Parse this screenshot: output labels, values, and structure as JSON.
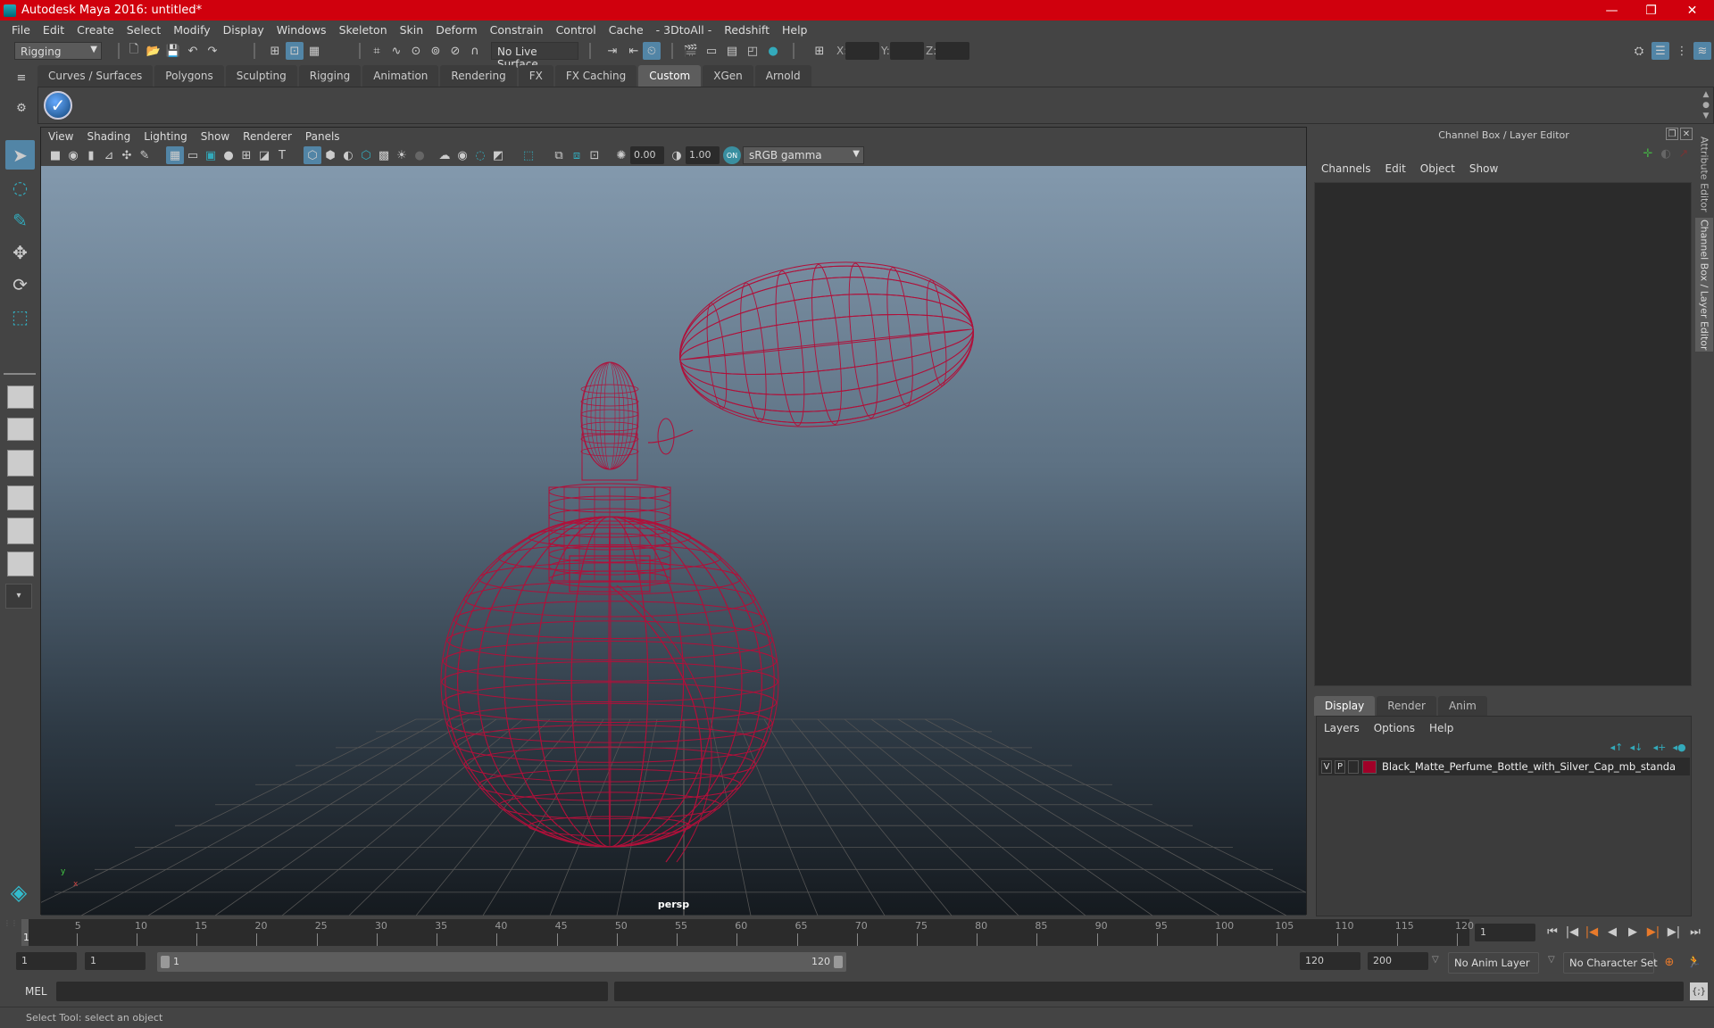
{
  "window": {
    "title": "Autodesk Maya 2016: untitled*",
    "controls": {
      "minimize": "—",
      "restore": "❐",
      "close": "✕"
    }
  },
  "menubar": [
    "File",
    "Edit",
    "Create",
    "Select",
    "Modify",
    "Display",
    "Windows",
    "Skeleton",
    "Skin",
    "Deform",
    "Constrain",
    "Control",
    "Cache",
    "- 3DtoAll -",
    "Redshift",
    "Help"
  ],
  "statusline": {
    "mode": "Rigging",
    "live_surface": "No Live Surface",
    "x_label": "X:",
    "y_label": "Y:",
    "z_label": "Z:",
    "x_value": "",
    "y_value": "",
    "z_value": ""
  },
  "shelf": {
    "tabs": [
      "Curves / Surfaces",
      "Polygons",
      "Sculpting",
      "Rigging",
      "Animation",
      "Rendering",
      "FX",
      "FX Caching",
      "Custom",
      "XGen",
      "Arnold"
    ],
    "active_tab": "Custom"
  },
  "viewport": {
    "menu": [
      "View",
      "Shading",
      "Lighting",
      "Show",
      "Renderer",
      "Panels"
    ],
    "exposure": "0.00",
    "gamma": "1.00",
    "color_space": "sRGB gamma",
    "camera_label": "persp",
    "wire_color": "#b0103a"
  },
  "channel_box": {
    "title": "Channel Box / Layer Editor",
    "menu": [
      "Channels",
      "Edit",
      "Object",
      "Show"
    ]
  },
  "side_tabs": [
    "Attribute Editor",
    "Channel Box / Layer Editor"
  ],
  "layer_editor": {
    "tabs": [
      "Display",
      "Render",
      "Anim"
    ],
    "active_tab": "Display",
    "menu": [
      "Layers",
      "Options",
      "Help"
    ],
    "layers": [
      {
        "visible": "V",
        "playback": "P",
        "color": "#a00028",
        "name": "Black_Matte_Perfume_Bottle_with_Silver_Cap_mb_standa"
      }
    ]
  },
  "timeline": {
    "ticks": [
      5,
      10,
      15,
      20,
      25,
      30,
      35,
      40,
      45,
      50,
      55,
      60,
      65,
      70,
      75,
      80,
      85,
      90,
      95,
      100,
      105,
      110,
      115,
      120
    ],
    "current_frame_label": "1",
    "current_frame_field": "1",
    "start": 1,
    "end": 120
  },
  "range": {
    "start_field": "1",
    "start_playback": "1",
    "slider_start": "1",
    "slider_end": "120",
    "end_playback": "120",
    "end_field": "200",
    "anim_layer": "No Anim Layer",
    "character_set": "No Character Set"
  },
  "command": {
    "language": "MEL",
    "input": "",
    "output": ""
  },
  "help_line": "Select Tool: select an object"
}
